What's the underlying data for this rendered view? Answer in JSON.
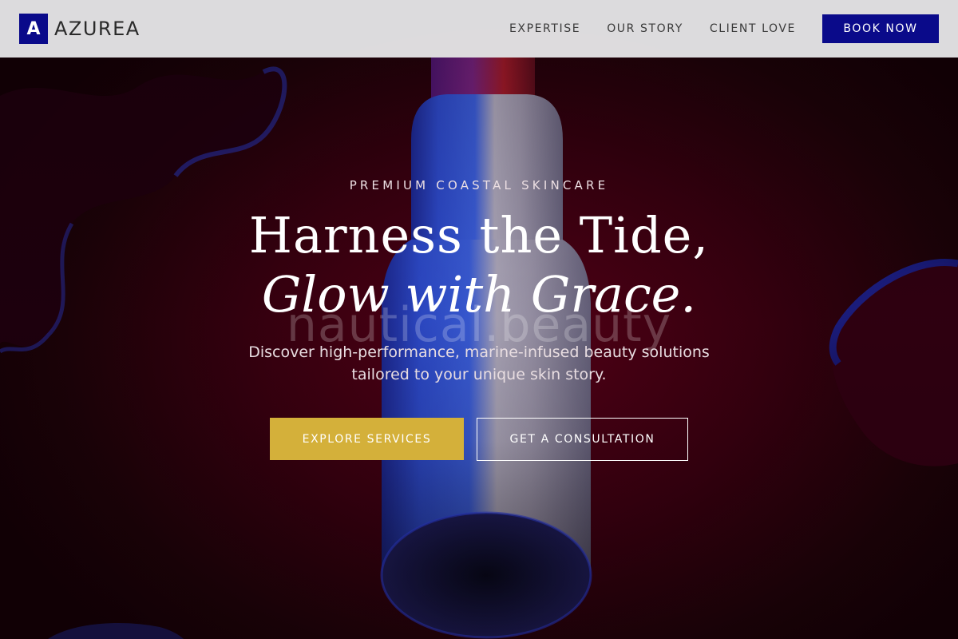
{
  "brand": {
    "mark_letter": "A",
    "name": "AZUREA",
    "color": "#0a0a8a"
  },
  "nav": {
    "links": [
      "EXPERTISE",
      "OUR STORY",
      "CLIENT LOVE"
    ],
    "book_label": "BOOK NOW"
  },
  "hero": {
    "eyebrow": "PREMIUM COASTAL SKINCARE",
    "headline_line1": "Harness the Tide,",
    "headline_line2": "Glow with Grace.",
    "watermark": "nautical.beauty",
    "subtext": "Discover high-performance, marine-infused beauty solutions tailored to your unique skin story.",
    "primary_cta": "EXPLORE SERVICES",
    "secondary_cta": "GET A CONSULTATION",
    "primary_cta_color": "#d4b03a",
    "background_color": "#3a0010"
  }
}
